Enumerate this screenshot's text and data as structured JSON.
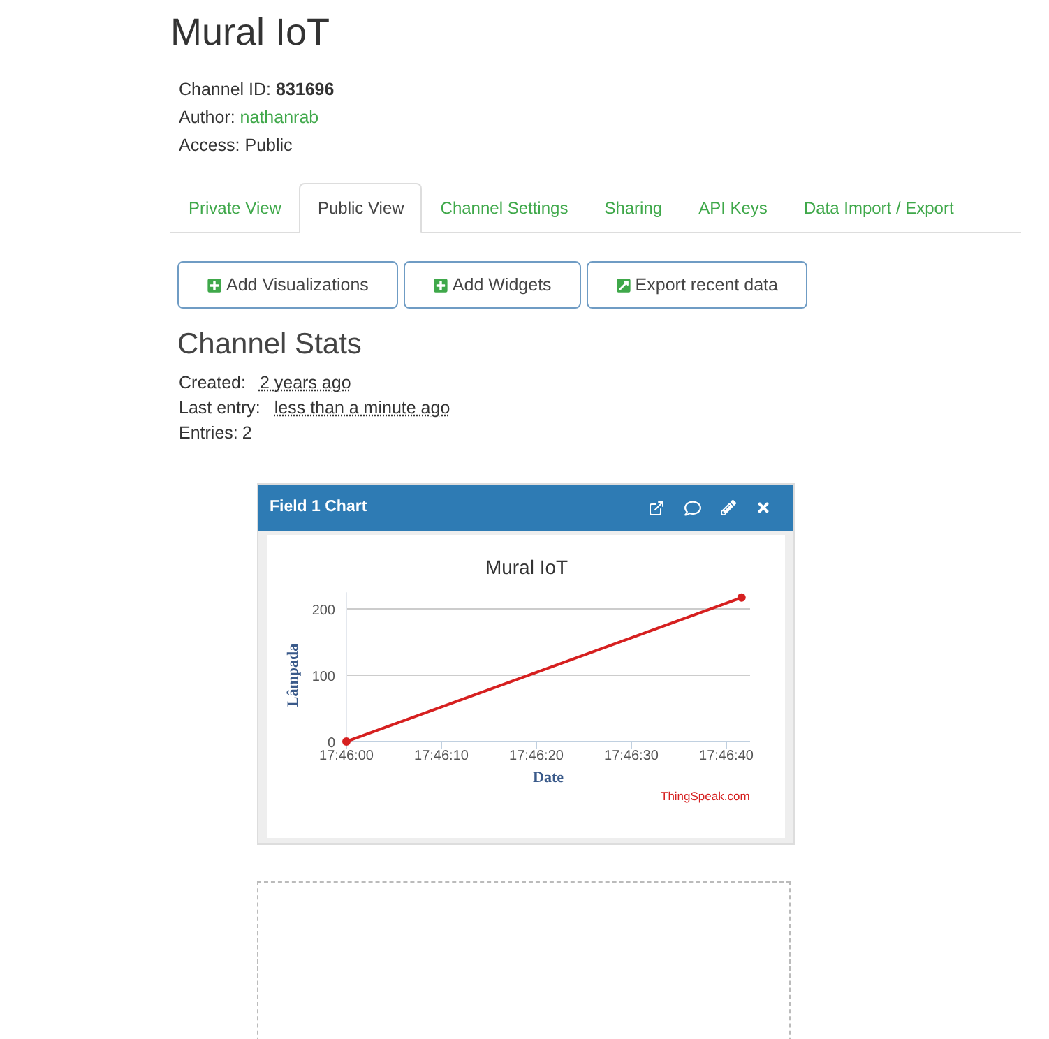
{
  "title": "Mural IoT",
  "meta": [
    {
      "label": "Channel ID:",
      "value": "831696",
      "kind": "bold"
    },
    {
      "label": "Author:",
      "value": "nathanrab",
      "kind": "link"
    },
    {
      "label": "Access:",
      "value": "Public",
      "kind": "plain"
    }
  ],
  "tabs": [
    {
      "label": "Private View",
      "selected": false
    },
    {
      "label": "Public View",
      "selected": true
    },
    {
      "label": "Channel Settings",
      "selected": false
    },
    {
      "label": "Sharing",
      "selected": false
    },
    {
      "label": "API Keys",
      "selected": false
    },
    {
      "label": "Data Import / Export",
      "selected": false
    }
  ],
  "buttons": [
    {
      "label": "Add Visualizations",
      "kind": "plus"
    },
    {
      "label": "Add Widgets",
      "kind": "plus"
    },
    {
      "label": "Export recent data",
      "kind": "export"
    }
  ],
  "stats": {
    "heading": "Channel Stats",
    "items": [
      {
        "label": "Created:",
        "value": "2 years ago",
        "kind": "time"
      },
      {
        "label": "Last entry:",
        "value": "less than a minute ago",
        "kind": "time"
      },
      {
        "label": "Entries:",
        "value": "2",
        "kind": "plain"
      }
    ]
  },
  "widget": {
    "title": "Field 1 Chart",
    "credit": "ThingSpeak.com",
    "chart_data": {
      "type": "line",
      "title": "Mural IoT",
      "xlabel": "Date",
      "ylabel": "Lâmpada",
      "x": [
        63960,
        64001.6
      ],
      "series": [
        {
          "color": "#d62020",
          "marker": "circle",
          "values": [
            0,
            217
          ]
        }
      ],
      "xlim": [
        63960,
        64002.5
      ],
      "ylim": [
        0,
        225
      ],
      "xticks": [
        {
          "value": 63960,
          "label": "17:46:00"
        },
        {
          "value": 63970,
          "label": "17:46:10"
        },
        {
          "value": 63980,
          "label": "17:46:20"
        },
        {
          "value": 63990,
          "label": "17:46:30"
        },
        {
          "value": 64000,
          "label": "17:46:40"
        }
      ],
      "yticks": [
        0,
        100,
        200
      ]
    }
  }
}
